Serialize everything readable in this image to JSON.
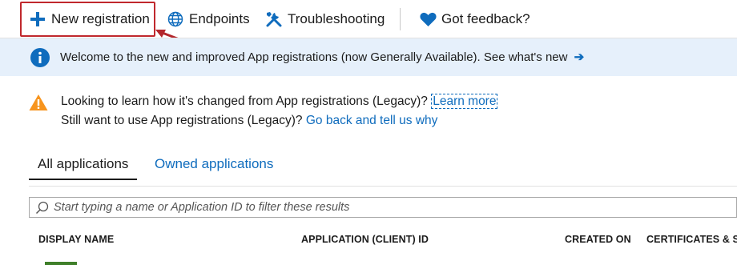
{
  "toolbar": {
    "new_registration": "New registration",
    "endpoints": "Endpoints",
    "troubleshooting": "Troubleshooting",
    "feedback": "Got feedback?"
  },
  "banner": {
    "message": "Welcome to the new and improved App registrations (now Generally Available). See what's new",
    "arrow": "➔"
  },
  "legacy_notice": {
    "line1_text": "Looking to learn how it's changed from App registrations (Legacy)?",
    "line1_link": "Learn more",
    "line2_text": "Still want to use App registrations (Legacy)?",
    "line2_link": "Go back and tell us why"
  },
  "tabs": [
    {
      "label": "All applications",
      "active": true
    },
    {
      "label": "Owned applications",
      "active": false
    }
  ],
  "search": {
    "placeholder": "Start typing a name or Application ID to filter these results"
  },
  "table": {
    "columns": [
      "DISPLAY NAME",
      "APPLICATION (CLIENT) ID",
      "CREATED ON",
      "CERTIFICATES & SE"
    ]
  },
  "colors": {
    "accent": "#0f6cbd",
    "banner_bg": "#e6f0fb",
    "highlight": "#c0282d",
    "warning": "#f7941d",
    "heart": "#0f6cbd",
    "avatar": "#3f7f2a"
  },
  "icons": {
    "new_registration": "plus-icon",
    "endpoints": "globe-icon",
    "troubleshooting": "tools-icon",
    "feedback": "heart-icon",
    "banner": "info-icon",
    "notice": "warning-icon",
    "search": "search-icon"
  }
}
